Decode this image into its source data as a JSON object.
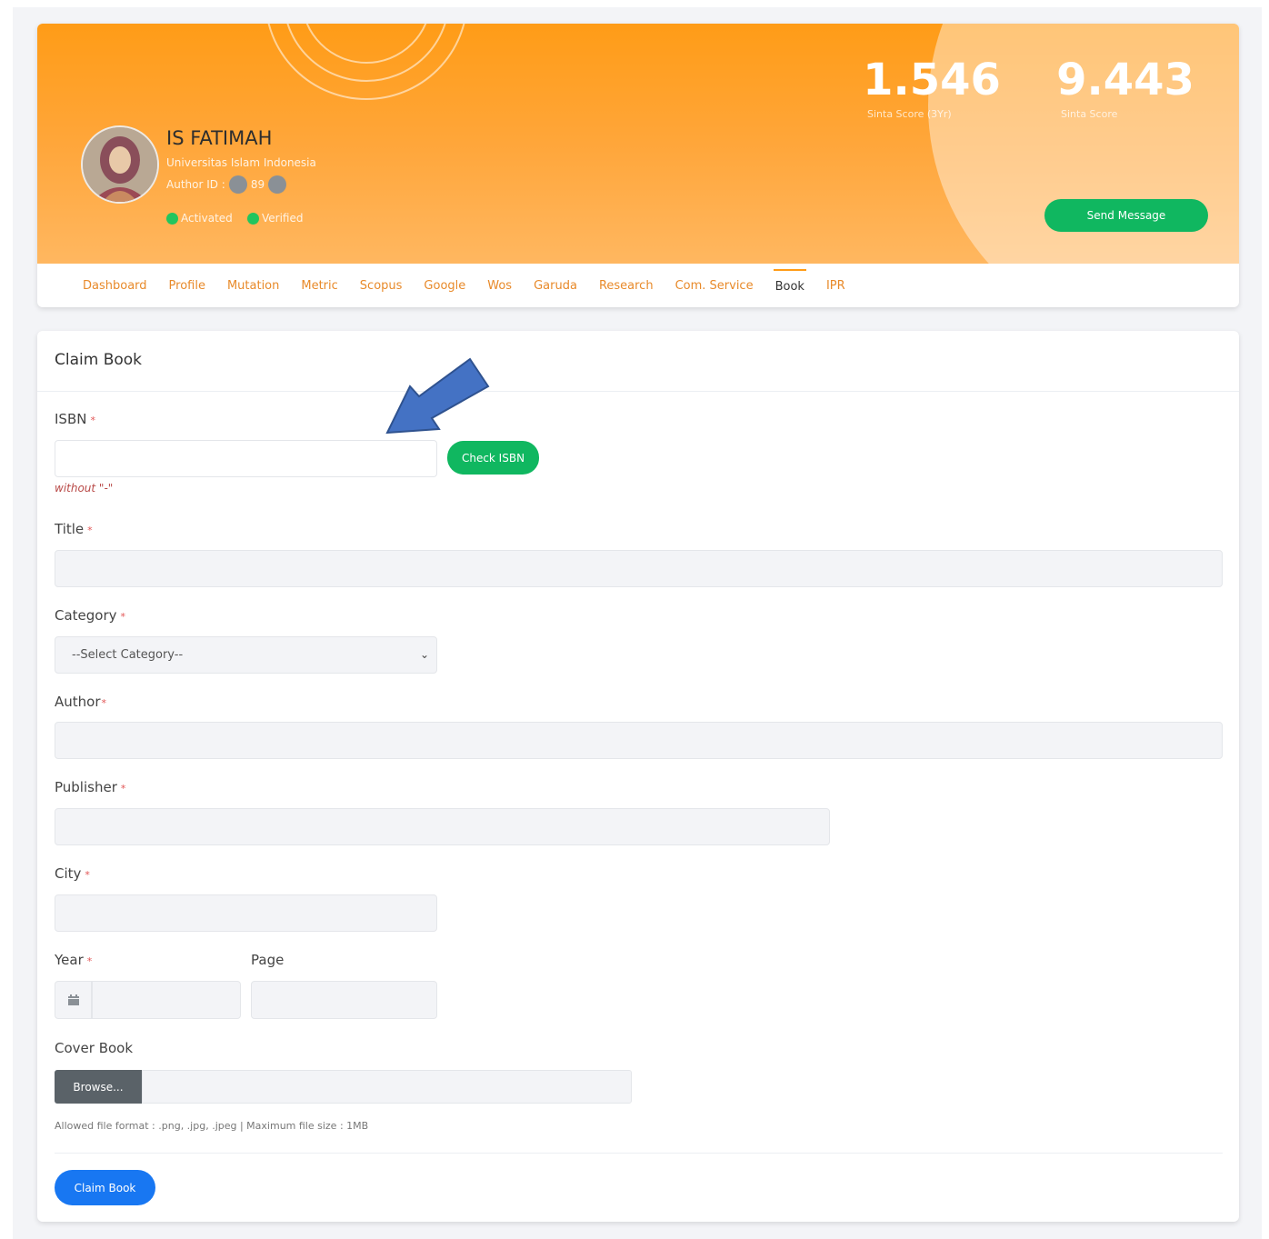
{
  "profile": {
    "name": "IS FATIMAH",
    "affiliation": "Universitas Islam Indonesia",
    "author_id_label": "Author ID :",
    "author_id_partial": "89",
    "status_activated": "Activated",
    "status_verified": "Verified",
    "status_color": "#22c55e"
  },
  "scores": [
    {
      "value": "1.546",
      "label": "Sinta Score (3Yr)"
    },
    {
      "value": "9.443",
      "label": "Sinta Score"
    }
  ],
  "send_message_label": "Send Message",
  "tabs": [
    "Dashboard",
    "Profile",
    "Mutation",
    "Metric",
    "Scopus",
    "Google",
    "Wos",
    "Garuda",
    "Research",
    "Com. Service",
    "Book",
    "IPR"
  ],
  "active_tab": "Book",
  "form": {
    "title": "Claim Book",
    "isbn_label": "ISBN",
    "isbn_value": "",
    "isbn_hint": "without \"-\"",
    "check_isbn_label": "Check ISBN",
    "title_label": "Title",
    "category_label": "Category",
    "category_selected": "--Select Category--",
    "author_label": "Author",
    "publisher_label": "Publisher",
    "city_label": "City",
    "year_label": "Year",
    "page_label": "Page",
    "cover_label": "Cover Book",
    "browse_label": "Browse...",
    "file_hint": "Allowed file format : .png, .jpg, .jpeg | Maximum file size : 1MB",
    "submit_label": "Claim Book",
    "required_mark": "*"
  },
  "colors": {
    "banner": "#ff9c17",
    "green_button": "#10b760",
    "blue_button": "#1877f2",
    "tab_text": "#e88a2a",
    "annotation_arrow": "#4472c4"
  },
  "icons": [
    "calendar-icon",
    "chevron-down-icon",
    "arrow-annotation-icon"
  ]
}
